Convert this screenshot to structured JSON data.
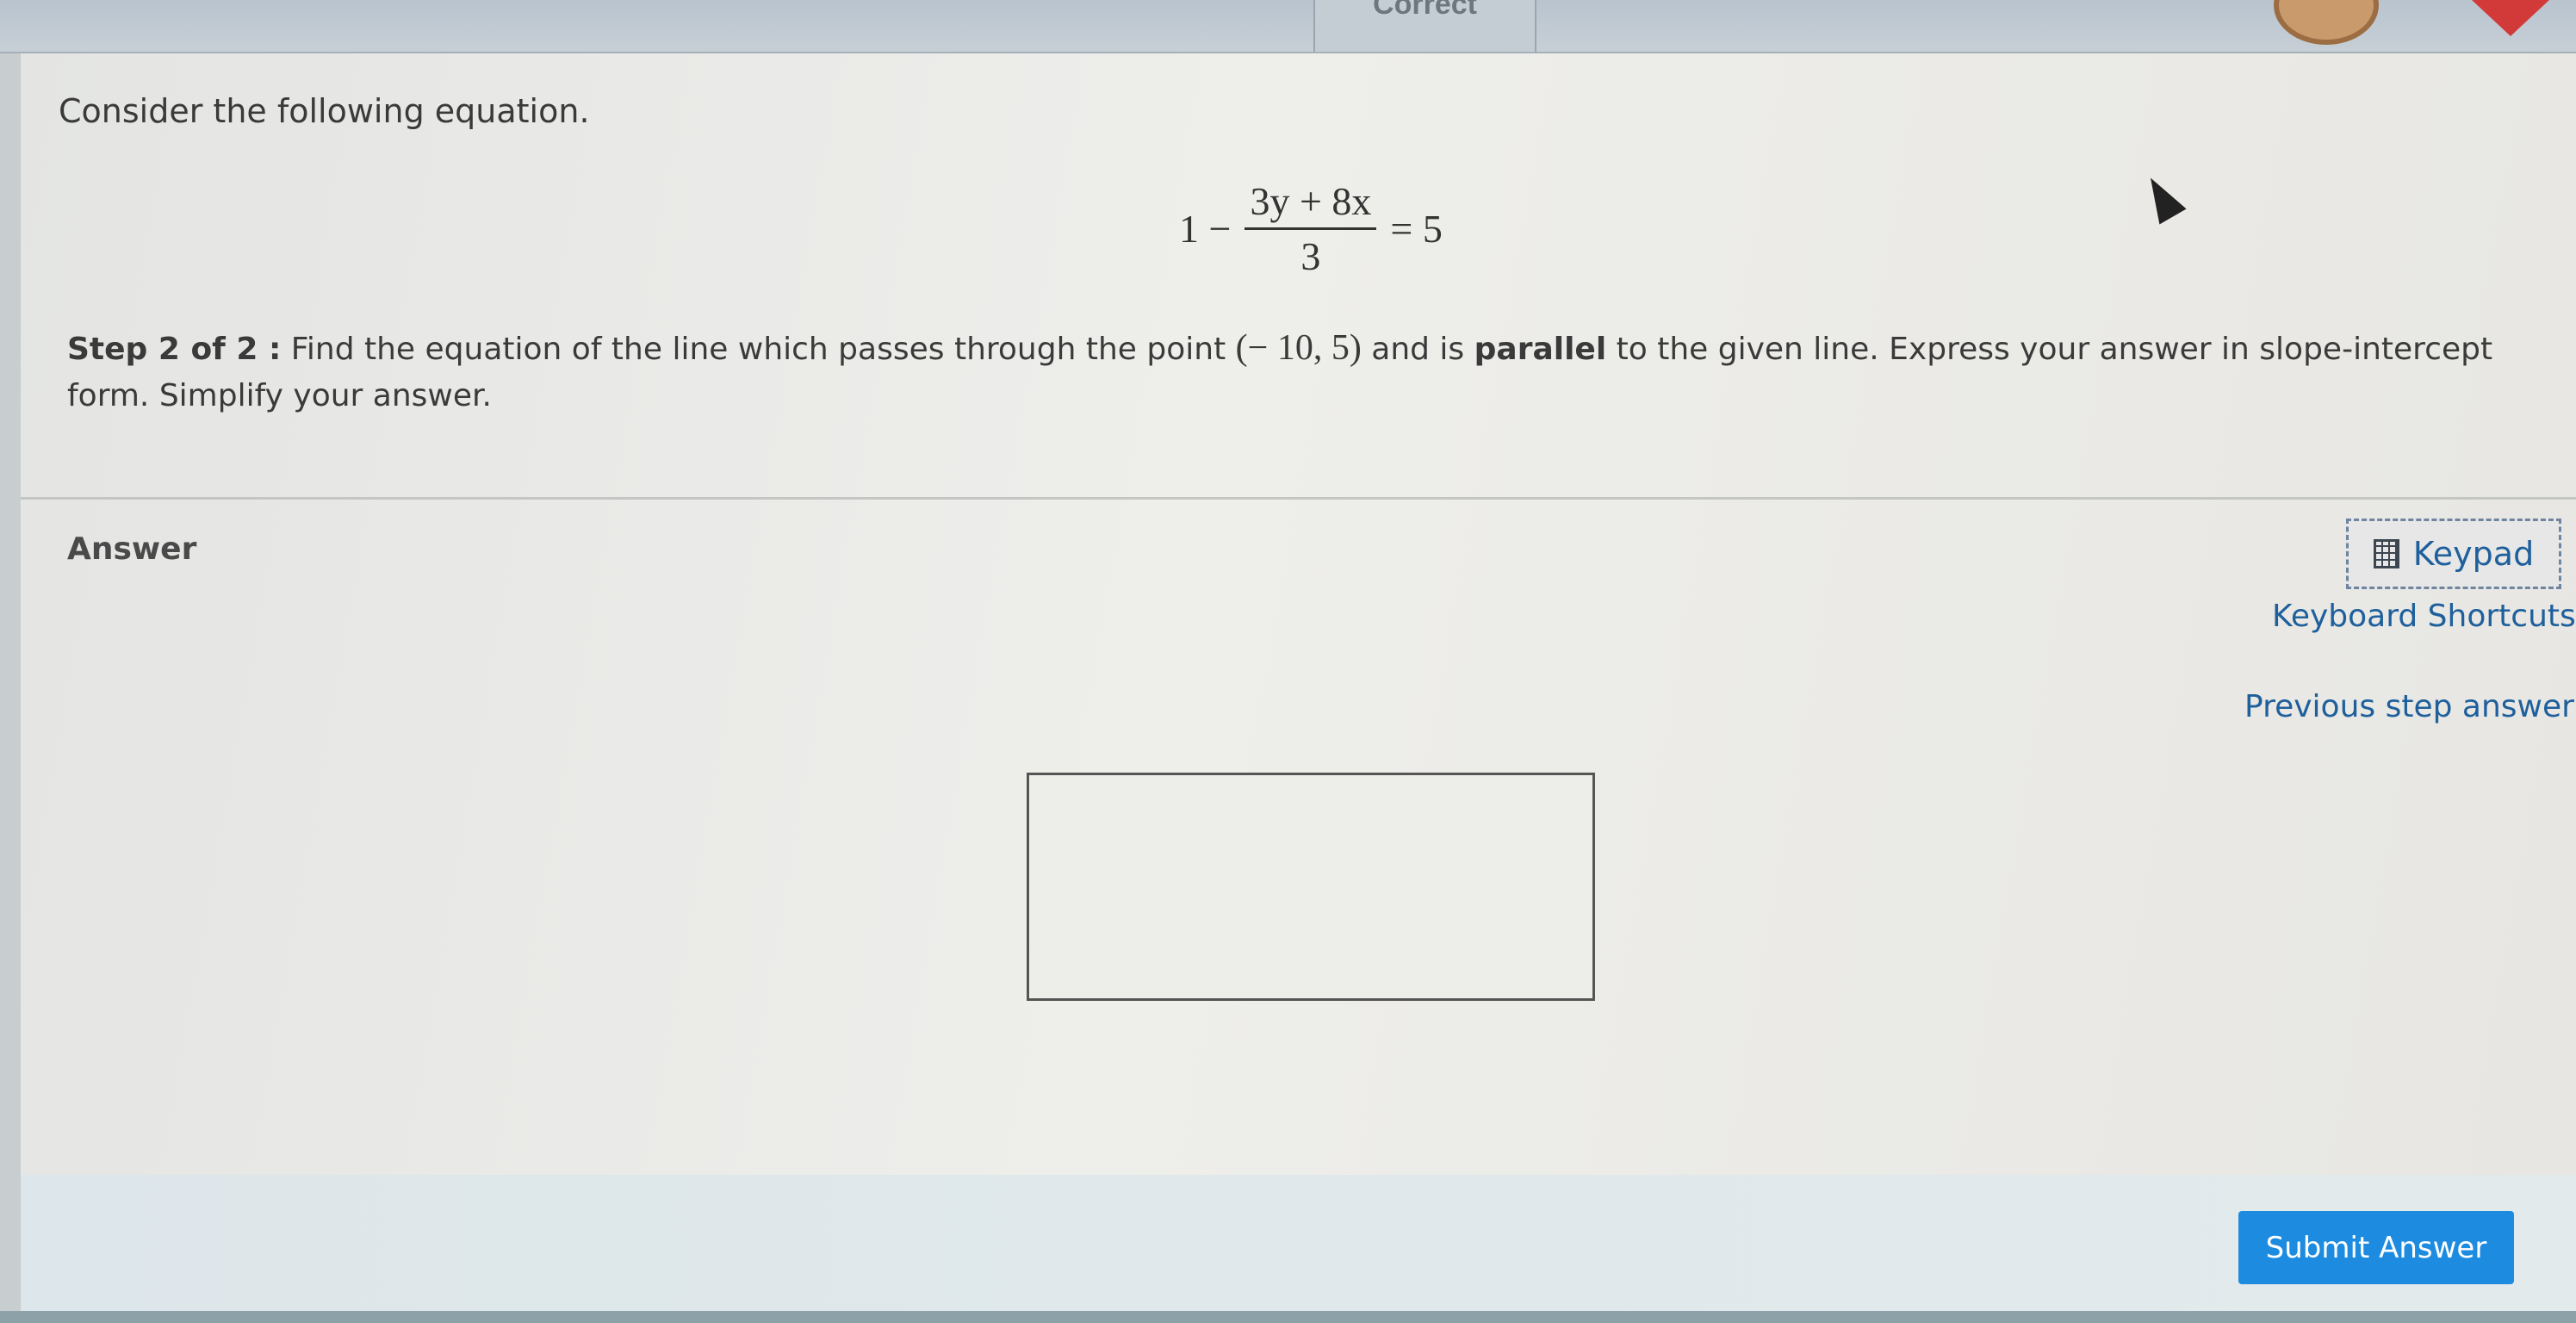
{
  "header": {
    "status_label": "Correct",
    "icons": [
      "ring-icon",
      "red-arrow-icon"
    ]
  },
  "question": {
    "prompt": "Consider the following equation.",
    "equation": {
      "left": "1 −",
      "numerator": "3y + 8x",
      "denominator": "3",
      "right": "= 5"
    },
    "step": {
      "label": "Step 2 of 2 :",
      "text_before": " Find the equation of the line which passes through the point ",
      "point": "(− 10, 5)",
      "text_middle": " and is ",
      "emphasis": "parallel",
      "text_after": " to the given line. Express your answer in slope-intercept form. Simplify your answer."
    }
  },
  "answer": {
    "label": "Answer",
    "keypad_label": "Keypad",
    "keyboard_shortcuts_label": "Keyboard Shortcuts",
    "previous_step_label": "Previous step answer",
    "input_value": ""
  },
  "footer": {
    "submit_label": "Submit Answer"
  },
  "colors": {
    "link": "#1e5f9c",
    "submit": "#1c8be0",
    "background": "#eeeeeb"
  }
}
